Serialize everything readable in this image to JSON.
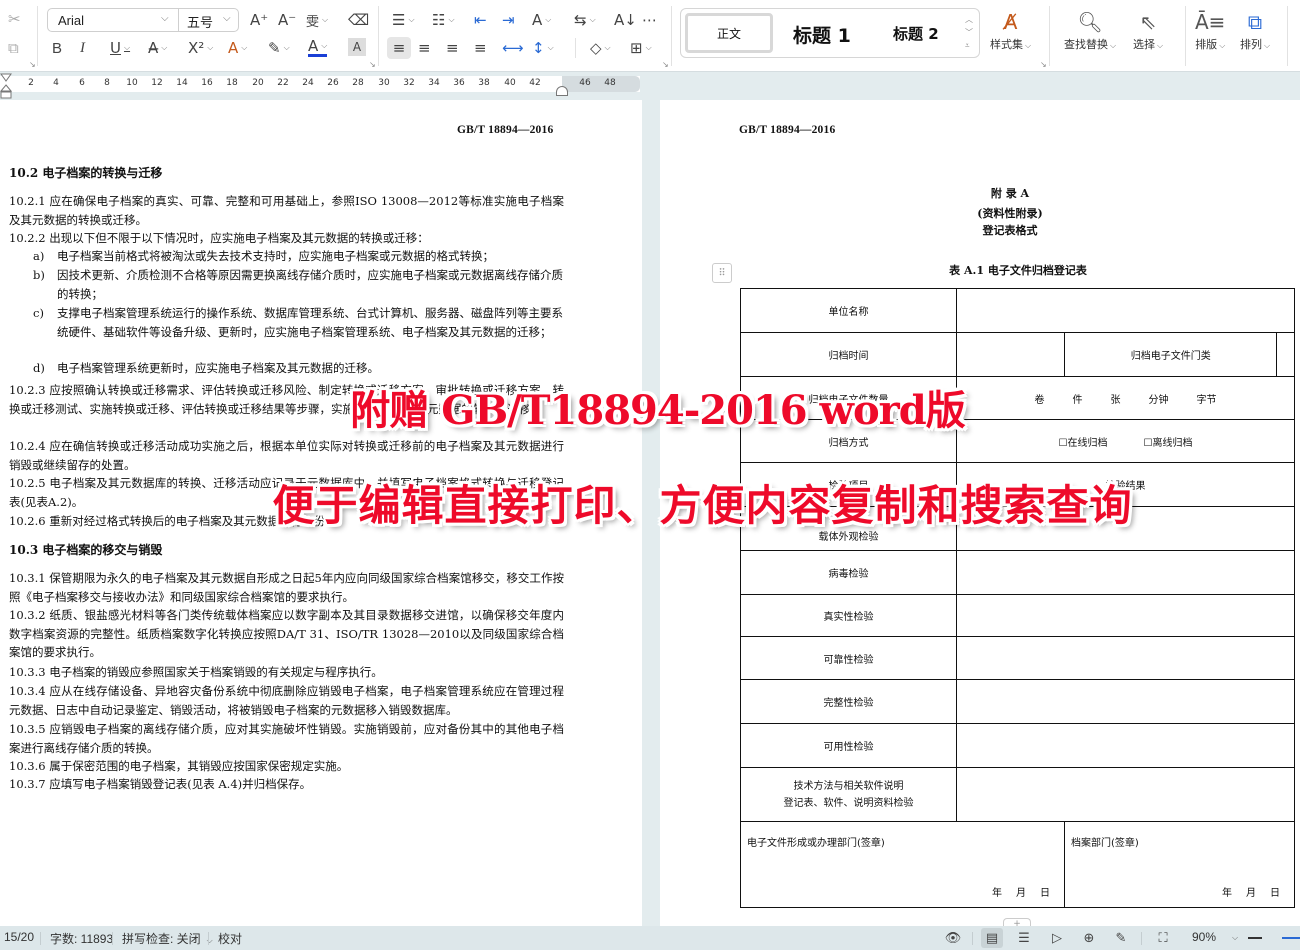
{
  "toolbar": {
    "font_name": "Arial",
    "font_size": "五号",
    "styles": {
      "normal": "正文",
      "heading1": "标题 1",
      "heading2": "标题 2"
    },
    "style_set_label": "样式集",
    "find_replace_label": "查找替换",
    "select_label": "选择",
    "layout_label": "排版",
    "arrange_label": "排列",
    "icons": {
      "cut": "✂",
      "copy": "⧉",
      "grow_font": "A⁺",
      "shrink_font": "A⁻",
      "phonetic": "雯",
      "clear_format": "⌫",
      "bold": "B",
      "italic": "I",
      "underline": "U",
      "strikethrough": "A̶",
      "superscript": "X²",
      "text_effect": "A",
      "highlight": "✎",
      "font_color": "A",
      "char_shading": "A",
      "bullets": "☰",
      "numbering": "☷",
      "decrease_indent": "⇤",
      "increase_indent": "⇥",
      "text_direction": "A",
      "sort": "⇆",
      "sort_az": "A↓",
      "tab_stops": "⋯",
      "align_left": "≡",
      "align_center": "≡",
      "align_right": "≡",
      "justify": "≡",
      "distribute": "⟷",
      "line_spacing": "↕",
      "shading": "◇",
      "borders": "⊞"
    },
    "font_color_hex": "#1a3fd6"
  },
  "ruler": {
    "ticks": [
      "2",
      "4",
      "6",
      "8",
      "10",
      "12",
      "14",
      "16",
      "18",
      "20",
      "22",
      "24",
      "26",
      "28",
      "30",
      "32",
      "34",
      "36",
      "38",
      "40",
      "42",
      "46",
      "48"
    ]
  },
  "left_page": {
    "header": "GB/T  18894—2016",
    "sec_10_2": "10.2   电子档案的转换与迁移",
    "p_10_2_1": "10.2.1   应在确保电子档案的真实、可靠、完整和可用基础上，参照ISO  13008—2012等标准实施电子档案及其元数据的转换或迁移。",
    "p_10_2_2": "10.2.2   出现以下但不限于以下情况时，应实施电子档案及其元数据的转换或迁移：",
    "items": [
      {
        "label": "a)",
        "text": "电子档案当前格式将被淘汰或失去技术支持时，应实施电子档案或元数据的格式转换；"
      },
      {
        "label": "b)",
        "text": "因技术更新、介质检测不合格等原因需更换离线存储介质时，应实施电子档案或元数据离线存储介质的转换；"
      },
      {
        "label": "c)",
        "text": "支撑电子档案管理系统运行的操作系统、数据库管理系统、台式计算机、服务器、磁盘阵列等主要系统硬件、基础软件等设备升级、更新时，应实施电子档案管理系统、电子档案及其元数据的迁移；"
      },
      {
        "label": "d)",
        "text": "电子档案管理系统更新时，应实施电子档案及其元数据的迁移。"
      }
    ],
    "p_10_2_3": "10.2.3   应按照确认转换或迁移需求、评估转换或迁移风险、制定转换或迁移方案、审批转换或迁移方案、转换或迁移测试、实施转换或迁移、评估转换或迁移结果等步骤，实施电子档案及/或元数据的转换或迁移。",
    "p_10_2_4": "10.2.4   应在确信转换或迁移活动成功实施之后，根据本单位实际对转换或迁移前的电子档案及其元数据进行销毁或继续留存的处置。",
    "p_10_2_5": "10.2.5   电子档案及其元数据库的转换、迁移活动应记录于元数据库中，并填写电子档案格式转换与迁移登记表(见表A.2)。",
    "p_10_2_6": "10.2.6   重新对经过格式转换后的电子档案及其元数据进行备份。",
    "sec_10_3": "10.3   电子档案的移交与销毁",
    "p_10_3_1": "10.3.1   保管期限为永久的电子档案及其元数据自形成之日起5年内应向同级国家综合档案馆移交，移交工作按照《电子档案移交与接收办法》和同级国家综合档案馆的要求执行。",
    "p_10_3_2": "10.3.2   纸质、银盐感光材料等各门类传统载体档案应以数字副本及其目录数据移交进馆，以确保移交年度内数字档案资源的完整性。纸质档案数字化转换应按照DA/T  31、ISO/TR  13028—2010以及同级国家综合档案馆的要求执行。",
    "p_10_3_3": "10.3.3   电子档案的销毁应参照国家关于档案销毁的有关规定与程序执行。",
    "p_10_3_4": "10.3.4   应从在线存储设备、异地容灾备份系统中彻底删除应销毁电子档案，电子档案管理系统应在管理过程元数据、日志中自动记录鉴定、销毁活动，将被销毁电子档案的元数据移入销毁数据库。",
    "p_10_3_5": "10.3.5   应销毁电子档案的离线存储介质，应对其实施破坏性销毁。实施销毁前，应对备份其中的其他电子档案进行离线存储介质的转换。",
    "p_10_3_6": "10.3.6   属于保密范围的电子档案，其销毁应按国家保密规定实施。",
    "p_10_3_7": "10.3.7   应填写电子档案销毁登记表(见表 A.4)并归档保存。"
  },
  "right_page": {
    "header": "GB/T   18894—2016",
    "appendix_title": "附    录  A",
    "appendix_type": "(资料性附录)",
    "appendix_subtitle": "登记表格式",
    "table_title": "表 A.1    电子文件归档登记表",
    "table": {
      "unit_name": "单位名称",
      "archive_time": "归档时间",
      "archive_category": "归档电子文件门类",
      "archive_quantity": "归档电子文件数量",
      "units": [
        "卷",
        "件",
        "张",
        "分钟",
        "字节"
      ],
      "archive_method": "归档方式",
      "options": [
        "☐在线归档",
        "☐离线归档"
      ],
      "check_item": "检验项目",
      "check_result": "检验结果",
      "checks": [
        "载体外观检验",
        "病毒检验",
        "真实性检验",
        "可靠性检验",
        "完整性检验",
        "可用性检验"
      ],
      "tech_line1": "技术方法与相关软件说明",
      "tech_line2": "登记表、软件、说明资料检验",
      "dept_forming": "电子文件形成或办理部门(签章)",
      "dept_archive": "档案部门(签章)",
      "date_parts": [
        "年",
        "月",
        "日"
      ]
    }
  },
  "overlay": {
    "line1": "附赠 GB/T18894-2016 word版",
    "line2": "便于编辑直接打印、方便内容复制和搜索查询",
    "color": "#ee0a2a"
  },
  "statusbar": {
    "page": "15/20",
    "word_count": "字数: 11893",
    "spell_check": "拼写检查: 关闭",
    "proofread": "校对",
    "zoom": "90%"
  }
}
